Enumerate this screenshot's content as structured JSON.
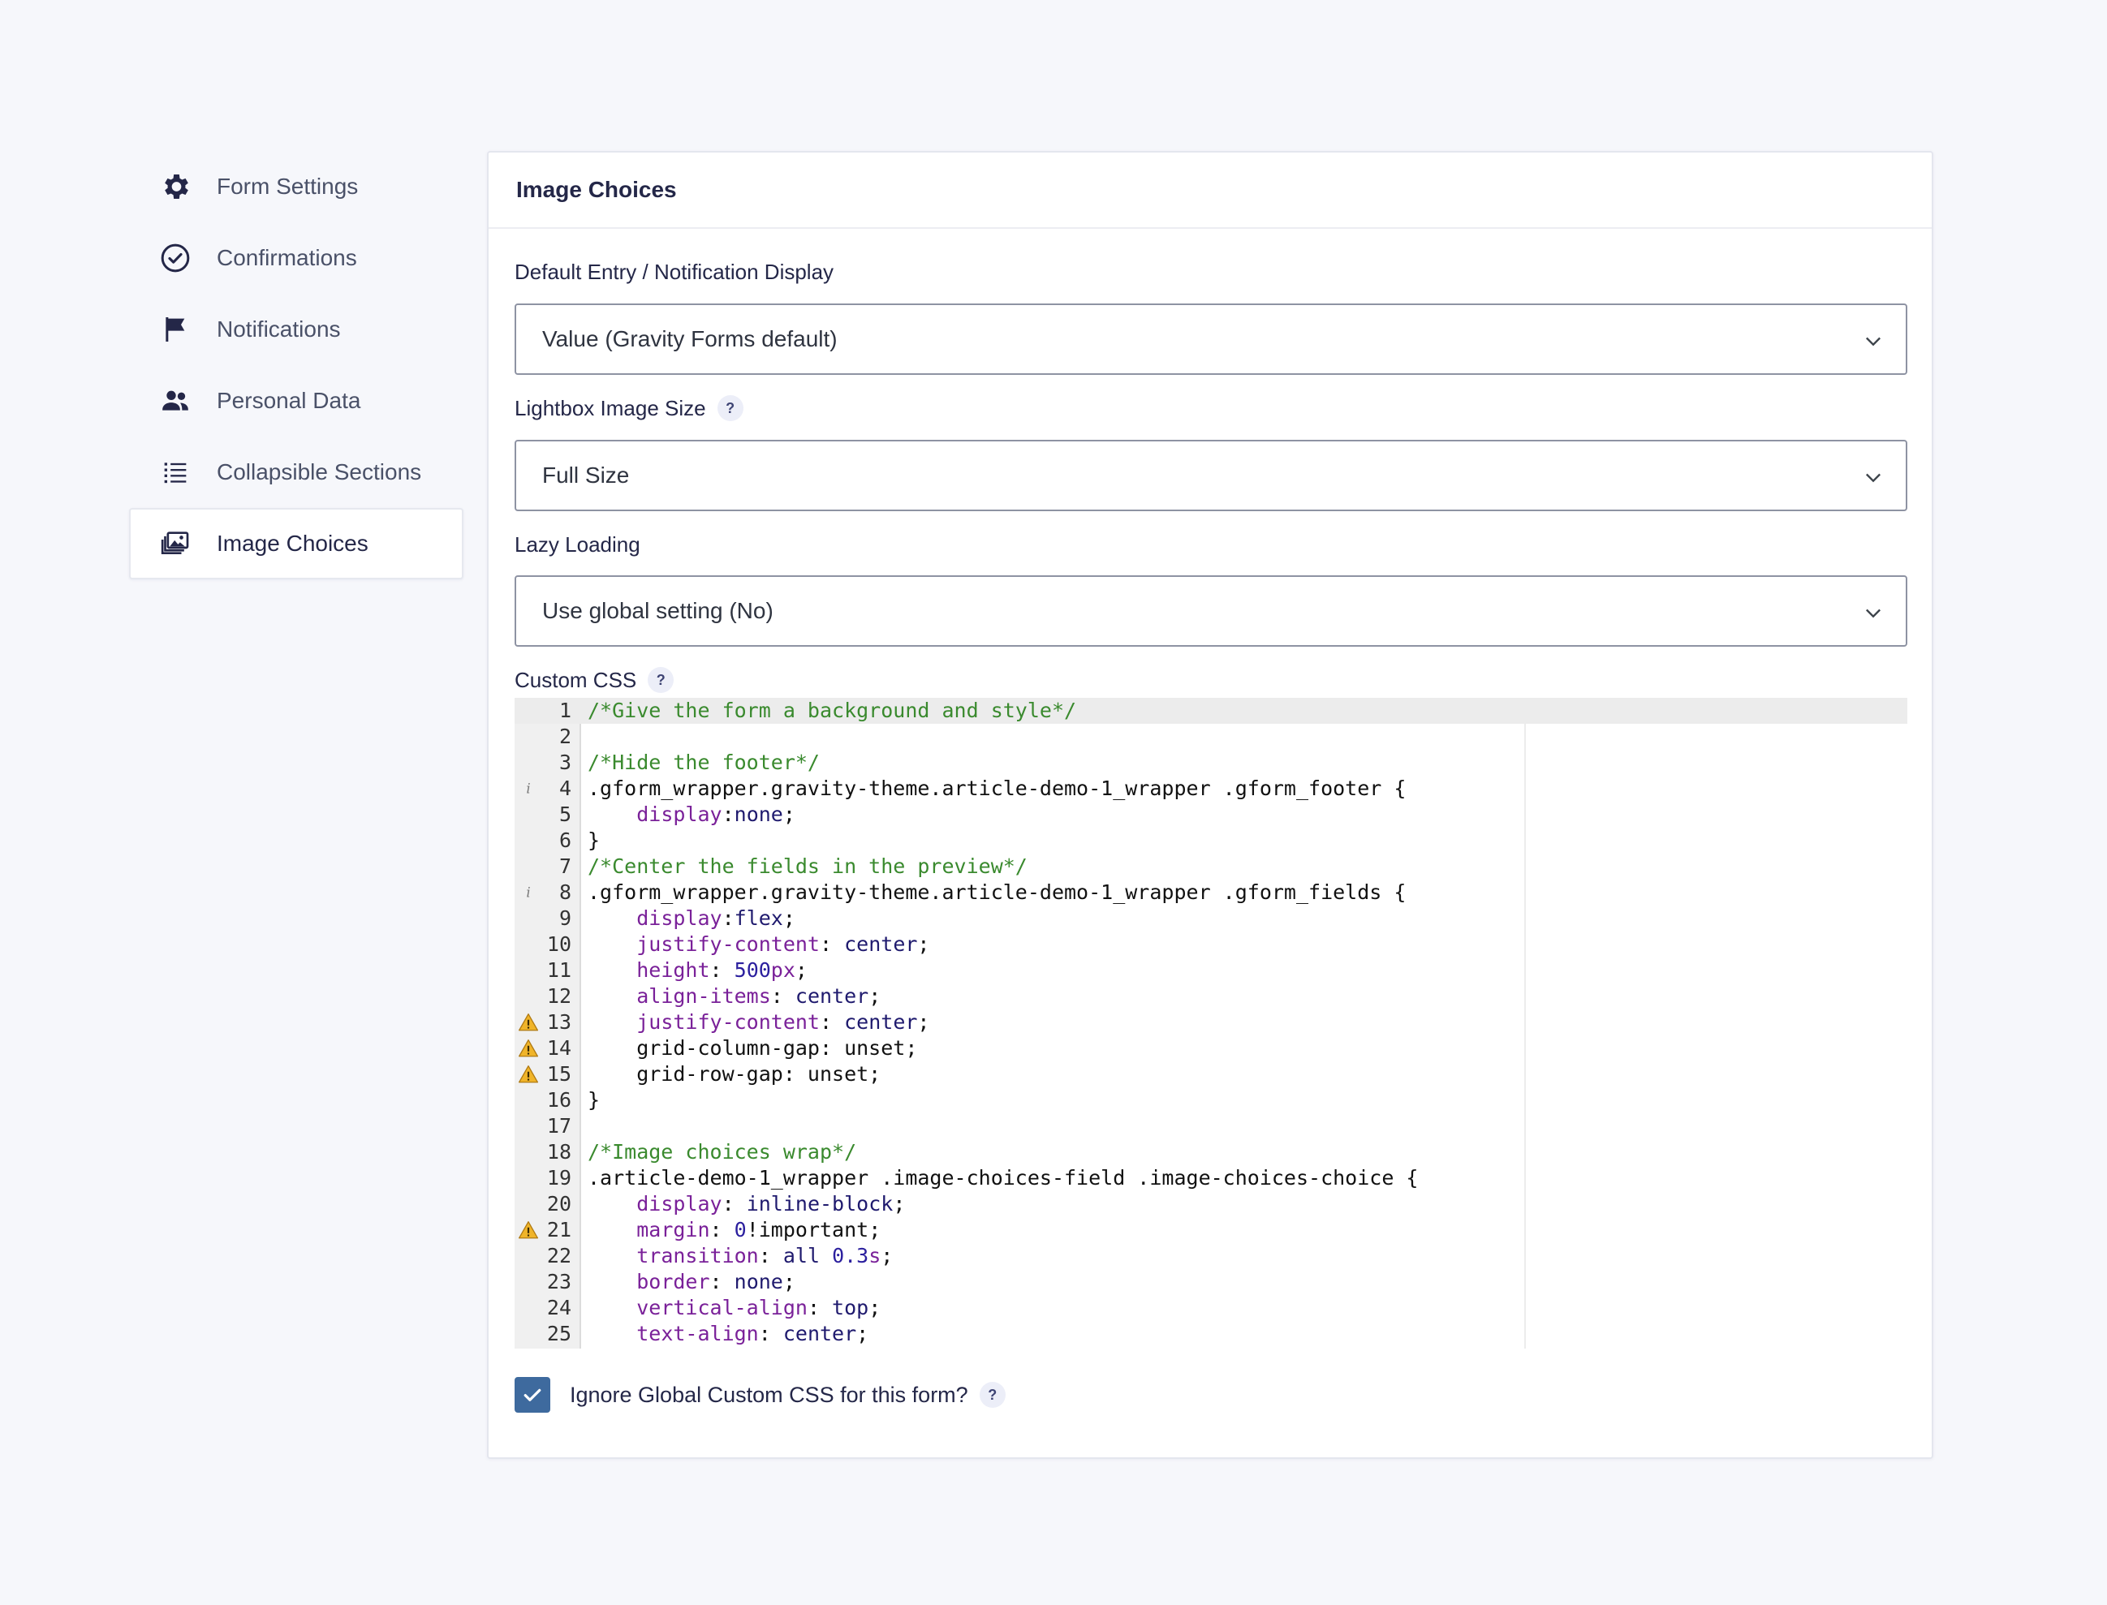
{
  "sidebar": {
    "items": [
      {
        "label": "Form Settings",
        "icon": "gear-icon"
      },
      {
        "label": "Confirmations",
        "icon": "check-circle-icon"
      },
      {
        "label": "Notifications",
        "icon": "flag-icon"
      },
      {
        "label": "Personal Data",
        "icon": "users-icon"
      },
      {
        "label": "Collapsible Sections",
        "icon": "list-icon"
      },
      {
        "label": "Image Choices",
        "icon": "images-icon",
        "active": true
      }
    ]
  },
  "panel": {
    "title": "Image Choices",
    "default_display": {
      "label": "Default Entry / Notification Display",
      "value": "Value (Gravity Forms default)"
    },
    "lightbox_size": {
      "label": "Lightbox Image Size",
      "help": "?",
      "value": "Full Size"
    },
    "lazy_loading": {
      "label": "Lazy Loading",
      "value": "Use global setting (No)"
    },
    "custom_css": {
      "label": "Custom CSS",
      "help": "?",
      "lines": [
        {
          "n": "1",
          "text": "/*Give the form a background and style*/"
        },
        {
          "n": "2",
          "text": ""
        },
        {
          "n": "3",
          "text": "/*Hide the footer*/"
        },
        {
          "n": "4",
          "text": ".gform_wrapper.gravity-theme.article-demo-1_wrapper .gform_footer {",
          "marker": "info"
        },
        {
          "n": "5",
          "text": "    display:none;"
        },
        {
          "n": "6",
          "text": "}"
        },
        {
          "n": "7",
          "text": "/*Center the fields in the preview*/"
        },
        {
          "n": "8",
          "text": ".gform_wrapper.gravity-theme.article-demo-1_wrapper .gform_fields {",
          "marker": "info"
        },
        {
          "n": "9",
          "text": "    display:flex;"
        },
        {
          "n": "10",
          "text": "    justify-content: center;"
        },
        {
          "n": "11",
          "text": "    height: 500px;"
        },
        {
          "n": "12",
          "text": "    align-items: center;"
        },
        {
          "n": "13",
          "text": "    justify-content: center;",
          "marker": "warning"
        },
        {
          "n": "14",
          "text": "    grid-column-gap: unset;",
          "marker": "warning"
        },
        {
          "n": "15",
          "text": "    grid-row-gap: unset;",
          "marker": "warning"
        },
        {
          "n": "16",
          "text": "}"
        },
        {
          "n": "17",
          "text": ""
        },
        {
          "n": "18",
          "text": "/*Image choices wrap*/"
        },
        {
          "n": "19",
          "text": ".article-demo-1_wrapper .image-choices-field .image-choices-choice {"
        },
        {
          "n": "20",
          "text": "    display: inline-block;"
        },
        {
          "n": "21",
          "text": "    margin: 0!important;",
          "marker": "warning"
        },
        {
          "n": "22",
          "text": "    transition: all 0.3s;"
        },
        {
          "n": "23",
          "text": "    border: none;"
        },
        {
          "n": "24",
          "text": "    vertical-align: top;"
        },
        {
          "n": "25",
          "text": "    text-align: center;"
        }
      ]
    },
    "ignore_global": {
      "label": "Ignore Global Custom CSS for this form?",
      "checked": true,
      "help": "?"
    }
  },
  "colors": {
    "accent": "#3e6a9e",
    "comment": "#3a8a2e",
    "property": "#7a2199",
    "number": "#2b1f9e"
  }
}
